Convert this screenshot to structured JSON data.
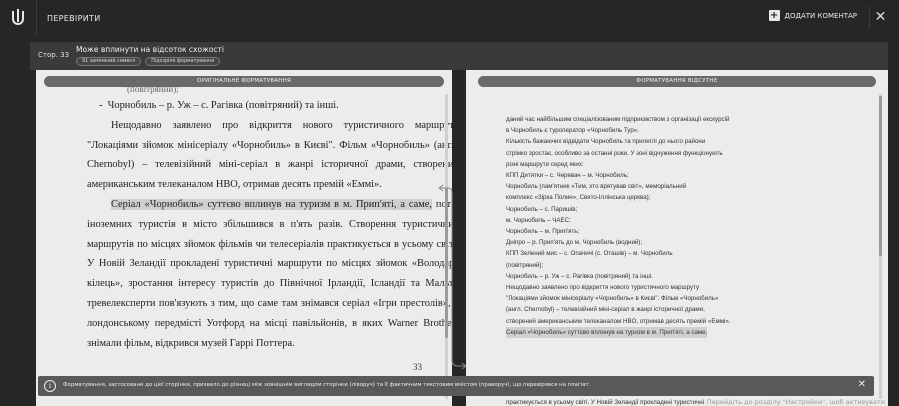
{
  "app": {
    "title": "ПЕРЕВІРИТИ",
    "add_comment": "ДОДАТИ КОМЕНТАР",
    "close_symbol": "✕"
  },
  "info": {
    "page_label": "Стор. 33",
    "title": "Може вплинути на відсоток схожості",
    "chips": [
      "91 замінений символ",
      "Підозріле форматування"
    ]
  },
  "left_panel": {
    "header": "ОРИГІНАЛЬНЕ ФОРМАТУВАННЯ",
    "top_cut_line": "(повітряний);",
    "bullet": "Чорнобиль – р. Уж – с. Рагівка (повітряний) та інші.",
    "paragraph1": "Нещодавно заявлено про відкриття нового туристичного маршруту \"Локаціями зйомок мінісеріалу «Чорнобиль» в Києві\". Фільм «Чорнобиль» (англ. Chernobyl) – телевізійний міні-серіал в жанрі історичної драми, створений американським телеканалом HBO, отримав десять премій «Еммі».",
    "paragraph2_highlight": "Серіал «Чорнобиль» суттєво вплинув на туризм в м. Прип'яті, а саме,",
    "paragraph2_rest": " потік іноземних туристів в місто збільшився в п'ять разів. Створення туристичних маршрутів по місцях зйомок фільмів чи телесеріалів практикується в усьому світі. У Новій Зеландії прокладені туристичні маршрути по місцях зйомок «Володаря кілець», зростання інтересу туристів до Північної Ірландії, Ісландії та Мальти тревелексперти пов'язують з тим, що саме там знімався серіал «Ігри престолів», в лондонському передмісті Уотфорд на місці павільйонів, в яких Warner Brothers знімали фільм, відкрився музей Гаррі Поттера.",
    "page_number": "33"
  },
  "right_panel": {
    "header": "ФОРМАТУВАННЯ ВІДСУТНЄ",
    "lines": [
      "даний час найбільшим спеціалізованим підприємством з організації екскурсій",
      "в Чорнобиль є туроператор «Чорнобиль Тур».",
      "Кількість бажаючих відвідати Чорнобиль та прилеглі до нього райони",
      "стрімко зростає, особливо за останні роки. У зоні відчуження функціонують",
      "різні маршрути серед яких:",
      "КПП Дитятки – с. Черевач – м. Чорнобиль;",
      "Чорнобиль (пам'ятник «Тим, хто врятував світ», меморіальний",
      "комплекс «Зірка Полин», Свято-Іллінська церква);",
      "Чорнобиль – с. Паришів;",
      "м. Чорнобиль – ЧАЕС;",
      "Чорнобиль – м. Прип'ять;",
      "Дніпро – р. Прип'ять до м. Чорнобиль (водний);",
      "КПП Зелений мис – с. Опачичі (с. Оташів) – м. Чорнобиль",
      "(повітряний);",
      "Чорнобиль – р. Уж – с. Рагівка (повітряний) та інші.",
      "Нещодавно заявлено про відкриття нового туристичного маршруту",
      "\"Локаціями зйомок мінісеріалу «Чорнобиль» в Києві\". Фільм «Чорнобиль»",
      "(англ. Chernobyl) – телевізійний міні-серіал в жанрі історичної драми,",
      "створений американським телеканалом HBO, отримав десять премій «Еммі»."
    ],
    "highlight_line": "Серіал «Чорнобиль» суттєво вплинув на туризм в м. Прип'яті, а саме,",
    "overflow_line": "практикується в усьому світі. У Новій Зеландії прокладені туристичні"
  },
  "notice": {
    "text": "Форматування, застосоване до цієї сторінки, призвело до різниці між зовнішнім виглядом сторінки (ліворуч) та її фактичним текстовим вмістом (праворуч), що перевірявся на плагіат.",
    "close_symbol": "✕"
  },
  "watermark": "Перейдіть до розділу \"Настройки\", щоб активувати"
}
